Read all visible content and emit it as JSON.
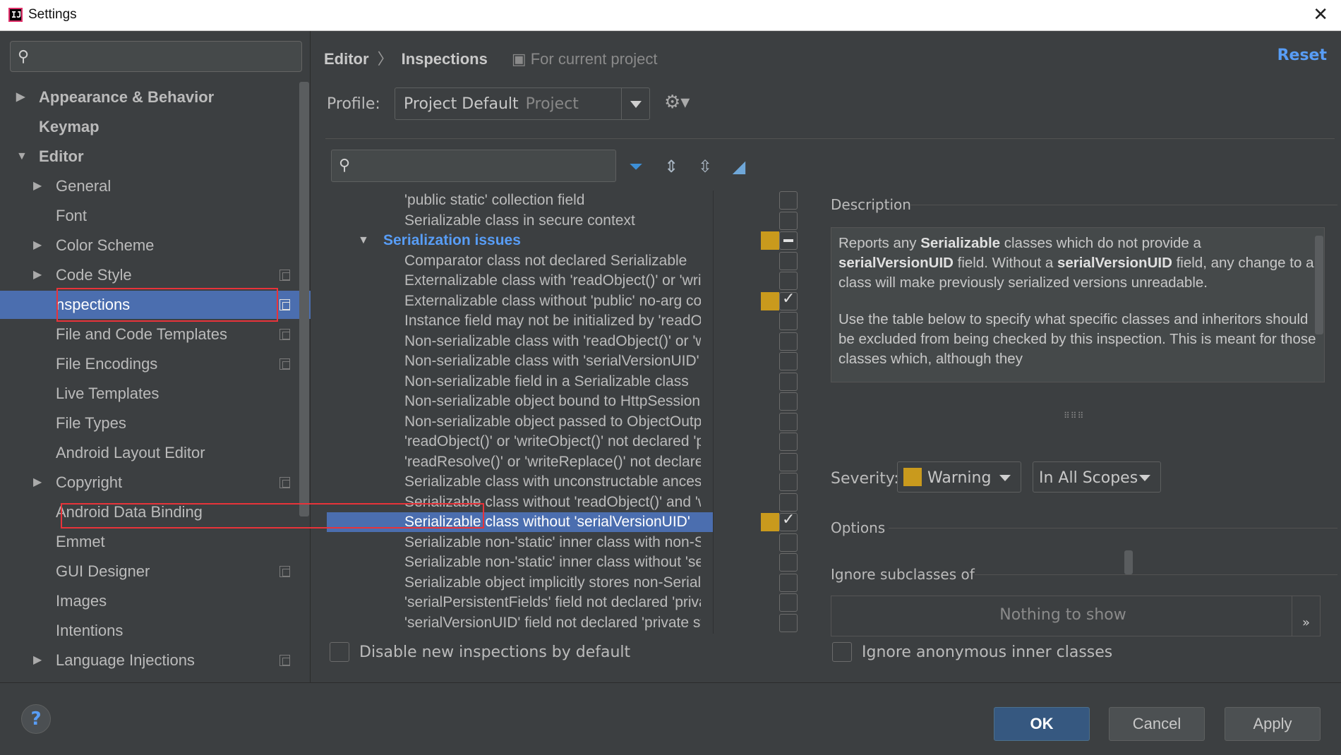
{
  "window": {
    "title": "Settings",
    "close_glyph": "✕",
    "app_icon": "intellij-icon"
  },
  "sidebar": {
    "search_placeholder": "",
    "items": [
      {
        "label": "Appearance & Behavior",
        "bold": true,
        "arrow": "▶",
        "copy": false
      },
      {
        "label": "Keymap",
        "bold": true,
        "arrow": "",
        "copy": false
      },
      {
        "label": "Editor",
        "bold": true,
        "arrow": "▼",
        "copy": false
      },
      {
        "label": "General",
        "arrow": "▶",
        "copy": false
      },
      {
        "label": "Font",
        "arrow": "",
        "copy": false
      },
      {
        "label": "Color Scheme",
        "arrow": "▶",
        "copy": false
      },
      {
        "label": "Code Style",
        "arrow": "▶",
        "copy": true
      },
      {
        "label": "nspections",
        "arrow": "",
        "copy": true,
        "selected": true
      },
      {
        "label": "File and Code Templates",
        "arrow": "",
        "copy": true
      },
      {
        "label": "File Encodings",
        "arrow": "",
        "copy": true
      },
      {
        "label": "Live Templates",
        "arrow": "",
        "copy": false
      },
      {
        "label": "File Types",
        "arrow": "",
        "copy": false
      },
      {
        "label": "Android Layout Editor",
        "arrow": "",
        "copy": false
      },
      {
        "label": "Copyright",
        "arrow": "▶",
        "copy": true
      },
      {
        "label": "Android Data Binding",
        "arrow": "",
        "copy": false
      },
      {
        "label": "Emmet",
        "arrow": "",
        "copy": false
      },
      {
        "label": "GUI Designer",
        "arrow": "",
        "copy": true
      },
      {
        "label": "Images",
        "arrow": "",
        "copy": false
      },
      {
        "label": "Intentions",
        "arrow": "",
        "copy": false
      },
      {
        "label": "Language Injections",
        "arrow": "▶",
        "copy": true
      }
    ]
  },
  "header": {
    "crumb_editor": "Editor",
    "crumb_sep": "〉",
    "crumb_current": "Inspections",
    "scope_note": "For current project",
    "reset": "Reset"
  },
  "profile": {
    "label": "Profile:",
    "value": "Project Default",
    "kind": "Project"
  },
  "toolbar": {
    "filter_icon": "filter-icon",
    "expand_icon": "expand-all-icon",
    "collapse_icon": "collapse-all-icon",
    "reset_icon": "eraser-icon"
  },
  "inspections": [
    {
      "text": "'public static' collection field",
      "chk": "off"
    },
    {
      "text": "Serializable class in secure context",
      "chk": "off"
    },
    {
      "text": "Serialization issues",
      "chk": "part",
      "group": true,
      "swatch": true
    },
    {
      "text": "Comparator class not declared Serializable",
      "chk": "off"
    },
    {
      "text": "Externalizable class with 'readObject()' or 'writeOb",
      "chk": "off"
    },
    {
      "text": "Externalizable class without 'public' no-arg constr",
      "chk": "on",
      "swatch": true
    },
    {
      "text": "Instance field may not be initialized by 'readObject",
      "chk": "off"
    },
    {
      "text": "Non-serializable class with 'readObject()' or 'write",
      "chk": "off"
    },
    {
      "text": "Non-serializable class with 'serialVersionUID'",
      "chk": "off"
    },
    {
      "text": "Non-serializable field in a Serializable class",
      "chk": "off"
    },
    {
      "text": "Non-serializable object bound to HttpSession",
      "chk": "off"
    },
    {
      "text": "Non-serializable object passed to ObjectOutputSt",
      "chk": "off"
    },
    {
      "text": "'readObject()' or 'writeObject()' not declared 'priva",
      "chk": "off"
    },
    {
      "text": "'readResolve()' or 'writeReplace()' not declared 'pr",
      "chk": "off"
    },
    {
      "text": "Serializable class with unconstructable ancestor",
      "chk": "off"
    },
    {
      "text": "Serializable class without 'readObject()' and 'write",
      "chk": "off"
    },
    {
      "text": "Serializable class without 'serialVersionUID'",
      "chk": "on",
      "swatch": true,
      "selected": true
    },
    {
      "text": "Serializable non-'static' inner class with non-Seria",
      "chk": "off"
    },
    {
      "text": "Serializable non-'static' inner class without 'serial'",
      "chk": "off"
    },
    {
      "text": "Serializable object implicitly stores non-Serializab",
      "chk": "off"
    },
    {
      "text": "'serialPersistentFields' field not declared 'private s",
      "chk": "off"
    },
    {
      "text": "'serialVersionUID' field not declared 'private static",
      "chk": "off"
    }
  ],
  "disable_new": "Disable new inspections by default",
  "description": {
    "label": "Description",
    "p1_a": "Reports any ",
    "p1_b": "Serializable",
    "p1_c": " classes which do not provide a ",
    "p1_d": "serialVersionUID",
    "p1_e": " field. Without a ",
    "p1_f": "serialVersionUID",
    "p1_g": " field, any change to a class will make previously serialized versions unreadable.",
    "p2": "Use the table below to specify what specific classes and inheritors should be excluded from being checked by this inspection. This is meant for those classes which, although they"
  },
  "severity": {
    "label": "Severity:",
    "value": "Warning",
    "color": "#c99a1d",
    "scope": "In All Scopes"
  },
  "options": {
    "label": "Options",
    "ignore_subclasses": "Ignore subclasses of",
    "nothing": "Nothing to show",
    "more": "»",
    "ignore_anon": "Ignore anonymous inner classes"
  },
  "footer": {
    "help": "?",
    "ok": "OK",
    "cancel": "Cancel",
    "apply": "Apply"
  }
}
